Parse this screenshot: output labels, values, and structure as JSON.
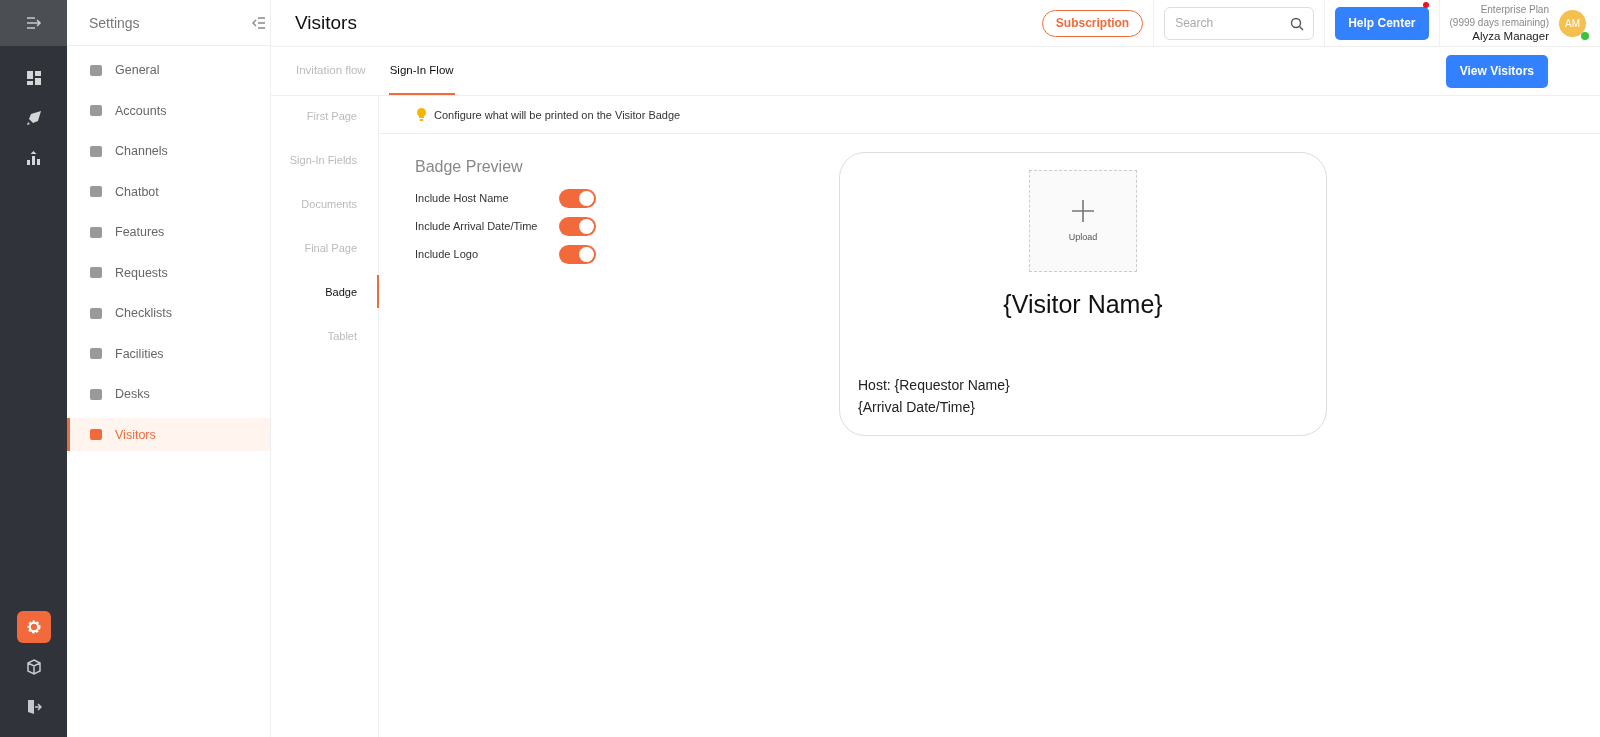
{
  "rail": {
    "top": [
      {
        "selected": false
      },
      {
        "selected": false
      },
      {
        "selected": false
      }
    ],
    "bottom": [
      {
        "selected": true
      },
      {
        "selected": false
      },
      {
        "selected": false
      }
    ]
  },
  "settings": {
    "title": "Settings",
    "items": [
      {
        "label": "General",
        "selected": false
      },
      {
        "label": "Accounts",
        "selected": false
      },
      {
        "label": "Channels",
        "selected": false
      },
      {
        "label": "Chatbot",
        "selected": false
      },
      {
        "label": "Features",
        "selected": false
      },
      {
        "label": "Requests",
        "selected": false
      },
      {
        "label": "Checklists",
        "selected": false
      },
      {
        "label": "Facilities",
        "selected": false
      },
      {
        "label": "Desks",
        "selected": false
      },
      {
        "label": "Visitors",
        "selected": true
      }
    ]
  },
  "header": {
    "title": "Visitors",
    "subscription": "Subscription",
    "search": {
      "placeholder": "Search"
    },
    "help": "Help Center",
    "help_notification": true,
    "plan": "Enterprise Plan",
    "plan_days": "(9999 days remaining)",
    "user": "Alyza Manager",
    "avatar": "AM",
    "online": true
  },
  "tabs": [
    {
      "label": "Invitation flow",
      "selected": false
    },
    {
      "label": "Sign-In Flow",
      "selected": true
    }
  ],
  "view_button": "View Visitors",
  "steps": [
    {
      "label": "First Page",
      "selected": false
    },
    {
      "label": "Sign-In Fields",
      "selected": false
    },
    {
      "label": "Documents",
      "selected": false
    },
    {
      "label": "Final Page",
      "selected": false
    },
    {
      "label": "Badge",
      "selected": true
    },
    {
      "label": "Tablet",
      "selected": false
    }
  ],
  "hint": "Configure what will be printed on the Visitor Badge",
  "badge_preview": {
    "title": "Badge Preview",
    "options": [
      {
        "label": "Include Host Name",
        "on": true
      },
      {
        "label": "Include Arrival Date/Time",
        "on": true
      },
      {
        "label": "Include Logo",
        "on": true
      }
    ]
  },
  "badge": {
    "upload": "Upload",
    "visitor": "{Visitor Name}",
    "host": "Host: {Requestor Name}",
    "arrival": "{Arrival Date/Time}"
  }
}
